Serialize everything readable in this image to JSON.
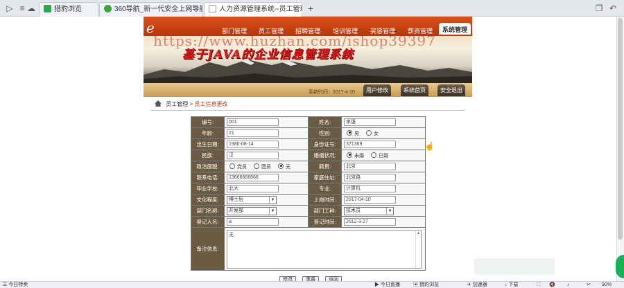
{
  "browser": {
    "tabs": [
      {
        "label": "猎豹浏览",
        "icon_color": "#2aa84a"
      },
      {
        "label": "360导航_新一代安全上网导航",
        "icon_color": "#3ba53b"
      },
      {
        "label": "人力资源管理系统--员工管理",
        "icon_color": "#999999"
      }
    ],
    "new_tab": "+"
  },
  "site": {
    "nav": [
      "部门管理",
      "员工管理",
      "招聘管理",
      "培训管理",
      "奖惩管理",
      "薪资管理",
      "系统管理"
    ],
    "active_nav": "系统管理",
    "title": "基于JAVA的企业信息管理系统",
    "watermark": "https://www.huzhan.com/ishop39397",
    "systime": "系统时间：2017-4-10",
    "band_buttons": [
      "用户修改",
      "系统首页",
      "安全退出"
    ],
    "logo_letter": "e"
  },
  "breadcrumb": {
    "section": "员工管理",
    "sep": ">",
    "current": "员工信息更改"
  },
  "form": {
    "rows": [
      {
        "l1": "编号:",
        "v1": "001",
        "l2": "姓名:",
        "v2": "李强"
      },
      {
        "l1": "年龄:",
        "v1": "21",
        "l2": "性别:",
        "radios2": [
          {
            "label": "男",
            "on": true
          },
          {
            "label": "女",
            "on": false
          }
        ]
      },
      {
        "l1": "出生日期:",
        "v1": "1980-08-14",
        "l2": "身份证号:",
        "v2": "371369"
      },
      {
        "l1": "民族:",
        "v1": "汉",
        "l2": "婚姻状况:",
        "radios2": [
          {
            "label": "未婚",
            "on": true
          },
          {
            "label": "已婚",
            "on": false
          }
        ]
      },
      {
        "l1": "政治面貌:",
        "radios1": [
          {
            "label": "党员",
            "on": false
          },
          {
            "label": "团员",
            "on": false
          },
          {
            "label": "无",
            "on": true
          }
        ],
        "l2": "籍贯:",
        "v2": "北京"
      },
      {
        "l1": "联系电话:",
        "v1": "13666666666",
        "l2": "家庭住址:",
        "v2": "北京路"
      },
      {
        "l1": "毕业学校:",
        "v1": "北大",
        "l2": "专业:",
        "v2": "计算机"
      },
      {
        "l1": "文化程度:",
        "s1": "博士后",
        "l2": "上岗时间:",
        "v2": "2017-04-10"
      },
      {
        "l1": "部门名称:",
        "s1": "开发部",
        "l2": "部门工种:",
        "s2": "技术员"
      },
      {
        "l1": "登记人名:",
        "v1": "a",
        "l2": "登记时间:",
        "v2": "2012-3-27"
      }
    ],
    "notes_label": "备注信息:",
    "notes_value": "无"
  },
  "actions": [
    "修改",
    "重置",
    "返回"
  ],
  "statusbar": {
    "left": "今日特卖",
    "items": [
      "今日直播",
      "猎豹浏览",
      "加速器",
      "下载"
    ],
    "zoom": "90%"
  }
}
